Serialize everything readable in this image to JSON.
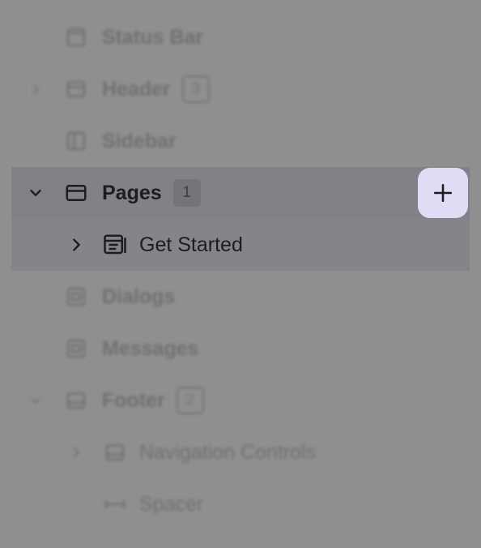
{
  "tree": {
    "status_bar": {
      "label": "Status Bar",
      "icon": "status-bar-icon"
    },
    "header": {
      "label": "Header",
      "count": "3",
      "icon": "header-icon"
    },
    "sidebar": {
      "label": "Sidebar",
      "icon": "sidebar-icon"
    },
    "pages": {
      "label": "Pages",
      "count": "1",
      "icon": "page-frame-icon"
    },
    "get_started": {
      "label": "Get Started",
      "icon": "page-screen-icon"
    },
    "dialogs": {
      "label": "Dialogs",
      "icon": "dialogs-icon"
    },
    "messages": {
      "label": "Messages",
      "icon": "messages-icon"
    },
    "footer": {
      "label": "Footer",
      "count": "2",
      "icon": "footer-icon"
    },
    "navigation_controls": {
      "label": "Navigation Controls",
      "icon": "navigation-icon"
    },
    "spacer": {
      "label": "Spacer",
      "icon": "spacer-icon"
    }
  },
  "actions": {
    "add_page": "plus-icon"
  },
  "colors": {
    "overlay": "#8f8f8f",
    "selected_row": "#838087",
    "add_button": "#e2dbf5",
    "text_dark": "#1d1d1f"
  }
}
